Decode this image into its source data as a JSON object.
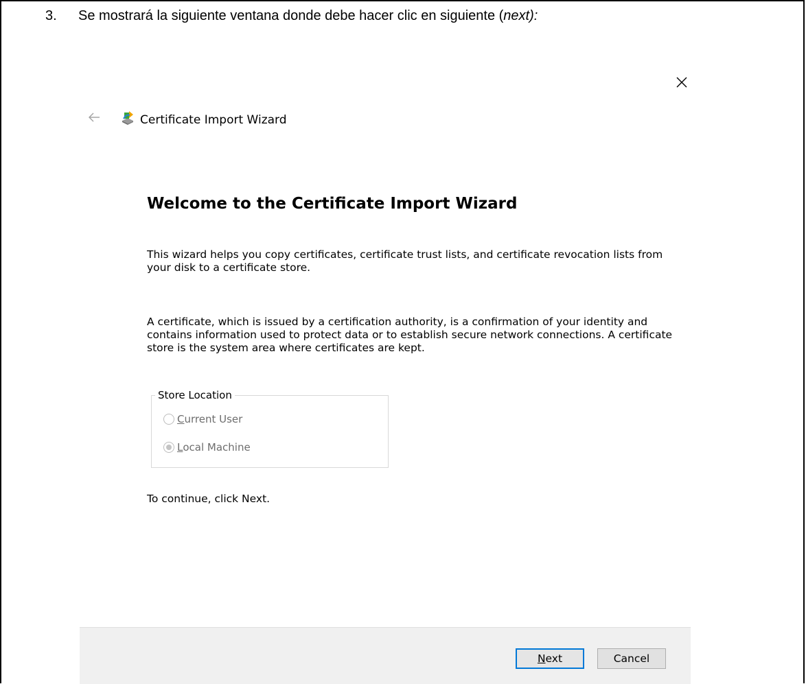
{
  "document": {
    "step_number": "3.",
    "step_text": "Se mostrará la siguiente ventana donde debe hacer clic en siguiente (",
    "step_emphasis": "next):"
  },
  "dialog": {
    "title": "Certificate Import Wizard",
    "heading": "Welcome to the Certificate Import Wizard",
    "paragraph1": "This wizard helps you copy certificates, certificate trust lists, and certificate revocation lists from your disk to a certificate store.",
    "paragraph2": "A certificate, which is issued by a certification authority, is a confirmation of your identity and contains information used to protect data or to establish secure network connections. A certificate store is the system area where certificates are kept.",
    "store_location": {
      "legend": "Store Location",
      "options": [
        {
          "label_first": "C",
          "label_rest": "urrent User",
          "checked": false,
          "enabled": false
        },
        {
          "label_first": "L",
          "label_rest": "ocal Machine",
          "checked": true,
          "enabled": false
        }
      ]
    },
    "continue_text": "To continue, click Next.",
    "buttons": {
      "next_first": "N",
      "next_rest": "ext",
      "cancel": "Cancel"
    },
    "icons": [
      "back-arrow-icon",
      "certificate-wizard-icon",
      "close-icon"
    ]
  }
}
